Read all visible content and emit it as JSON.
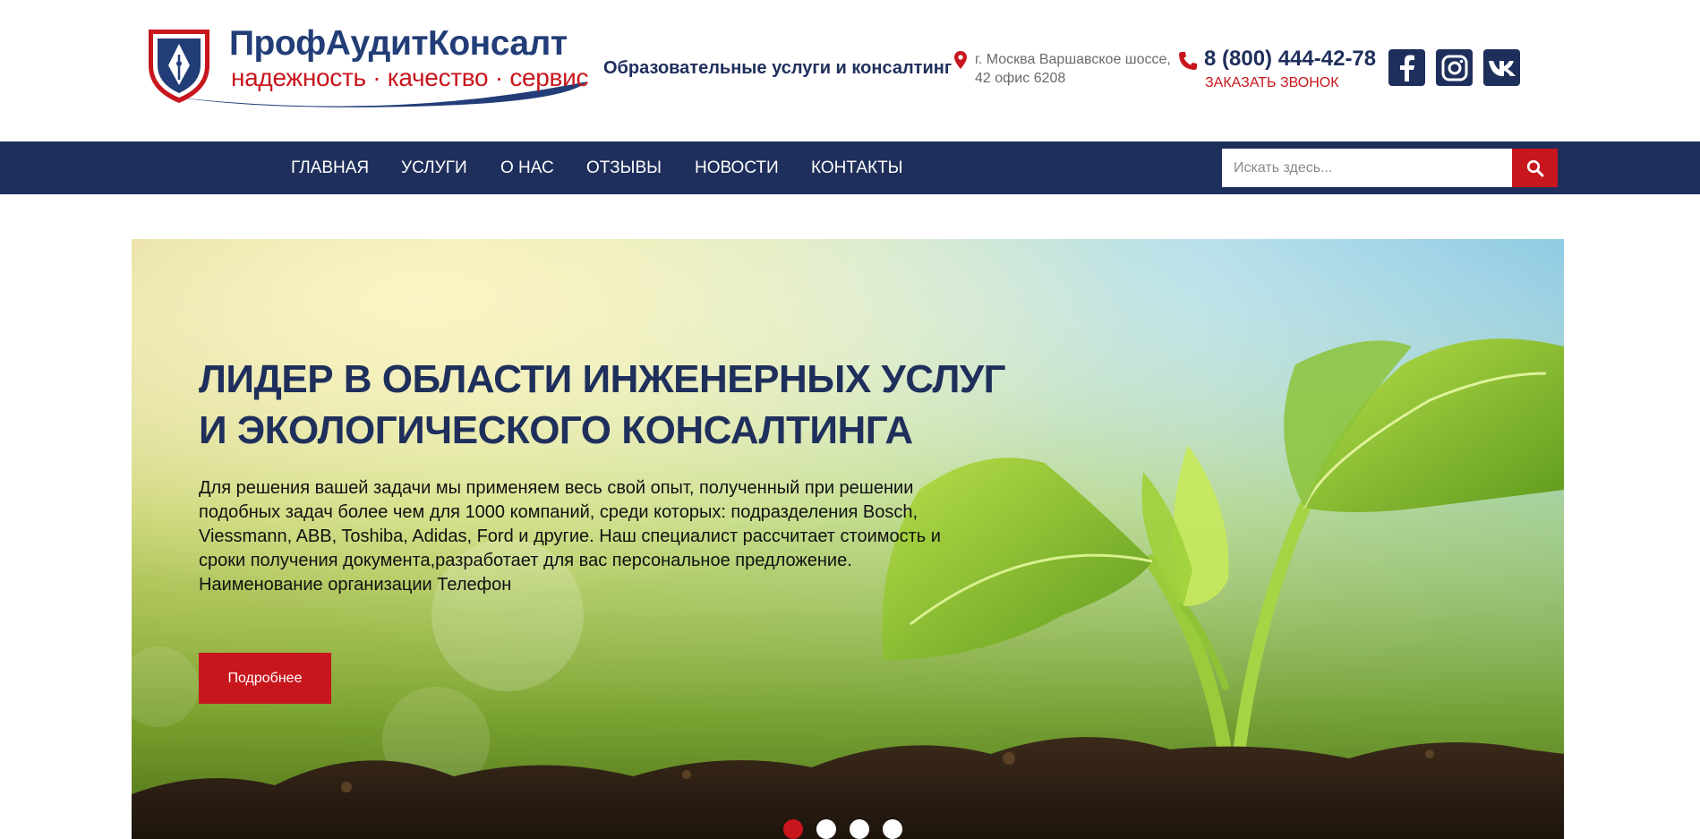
{
  "header": {
    "logo": {
      "title": "ПрофАудитКонсалт",
      "tagline": "надежность · качество · сервис"
    },
    "slogan": "Образовательные услуги и консалтинг",
    "address": "г. Москва Варшавское шоссе, 42 офис 6208",
    "phone": "8 (800) 444-42-78",
    "callback_label": "ЗАКАЗАТЬ ЗВОНОК",
    "social": [
      "facebook-icon",
      "instagram-icon",
      "vk-icon"
    ]
  },
  "nav": {
    "items": [
      {
        "label": "ГЛАВНАЯ"
      },
      {
        "label": "УСЛУГИ"
      },
      {
        "label": "О НАС"
      },
      {
        "label": "ОТЗЫВЫ"
      },
      {
        "label": "НОВОСТИ"
      },
      {
        "label": "КОНТАКТЫ"
      }
    ],
    "search": {
      "placeholder": "Искать здесь...",
      "value": ""
    }
  },
  "hero": {
    "title_line1": "ЛИДЕР В ОБЛАСТИ ИНЖЕНЕРНЫХ УСЛУГ",
    "title_line2": "И ЭКОЛОГИЧЕСКОГО КОНСАЛТИНГА",
    "text": "Для решения вашей задачи мы применяем весь свой опыт, полученный при решении подобных задач более чем для 1000 компаний, среди которых: подразделения Bosch, Viessmann, ABB, Toshiba, Adidas, Ford и другие. Наш специалист рассчитает стоимость и сроки получения документа,разработает для вас персональное предложение. Наименование организации Телефон",
    "button_label": "Подробнее",
    "slides_count": 4,
    "active_slide": 1
  },
  "colors": {
    "navy": "#1f2f5c",
    "red": "#c8161d",
    "white": "#ffffff"
  }
}
